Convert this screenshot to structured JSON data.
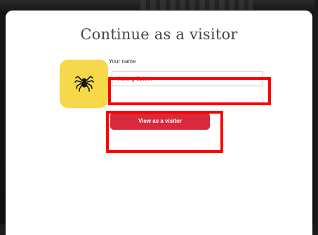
{
  "modal": {
    "title": "Continue as a visitor",
    "avatar_icon": "spider-icon",
    "avatar_color": "#f6d84a",
    "name_label": "Your name",
    "name_value": "Visiting Spider",
    "button_label": "View as a visitor",
    "button_color": "#d82a3a"
  },
  "annotations": {
    "highlight_color": "#ff0000"
  }
}
